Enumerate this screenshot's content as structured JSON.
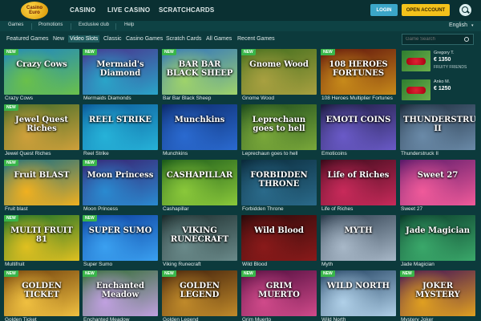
{
  "brand": {
    "logo_text": "Casino Euro"
  },
  "topnav": {
    "casino": "CASINO",
    "live_casino": "LIVE CASINO",
    "scratchcards": "SCRATCHCARDS"
  },
  "auth": {
    "login": "LOGIN",
    "open_account": "OPEN ACCOUNT"
  },
  "subnav": {
    "games": "Games",
    "promotions": "Promotions",
    "exclusive": "Exclusive club",
    "help": "Help",
    "language": "English"
  },
  "categories": [
    "Featured Games",
    "New",
    "Video Slots",
    "Classic",
    "Casino Games",
    "Scratch Cards",
    "All Games",
    "Recent Games"
  ],
  "search": {
    "placeholder": "Game Search"
  },
  "badge": "NEW",
  "winners": [
    {
      "name": "Gregory T.",
      "amount": "€ 1350",
      "game": "FRUITY FRIENDS"
    },
    {
      "name": "Anko M.",
      "amount": "€ 1250",
      "game": ""
    }
  ],
  "games": [
    {
      "label": "Crazy Cows",
      "title": "Crazy Cows",
      "new": true,
      "c1": "#1a84c9",
      "c2": "#6ac04a"
    },
    {
      "label": "Mermaids Diamonds",
      "title": "Mermaid's Diamond",
      "new": true,
      "c1": "#4a2c8a",
      "c2": "#2aa4c8"
    },
    {
      "label": "Bar Bar Black Sheep",
      "title": "BAR BAR BLACK SHEEP",
      "new": true,
      "c1": "#2a6fc4",
      "c2": "#9fd36a"
    },
    {
      "label": "Gnome Wood",
      "title": "Gnome Wood",
      "new": true,
      "c1": "#3c6b1c",
      "c2": "#a8a040"
    },
    {
      "label": "108 Heroes Multiplier Fortunes",
      "title": "108 HEROES FORTUNES",
      "new": true,
      "c1": "#5a0c0c",
      "c2": "#c78a1a"
    },
    {
      "label": "Jewel Quest Riches",
      "title": "Jewel Quest Riches",
      "new": true,
      "c1": "#3a6a2a",
      "c2": "#cfa03a"
    },
    {
      "label": "Reel Strike",
      "title": "REEL STRIKE",
      "new": false,
      "c1": "#0c5a9a",
      "c2": "#26b2d8"
    },
    {
      "label": "Munchkins",
      "title": "Munchkins",
      "new": false,
      "c1": "#0c2a6a",
      "c2": "#2a6ad0"
    },
    {
      "label": "Leprechaun goes to hell",
      "title": "Leprechaun goes to hell",
      "new": false,
      "c1": "#1c4a1c",
      "c2": "#7aa83a"
    },
    {
      "label": "Emoticoins",
      "title": "EMOTI COINS",
      "new": false,
      "c1": "#1a1a3a",
      "c2": "#6a5ac8"
    },
    {
      "label": "Thunderstruck II",
      "title": "THUNDERSTRUCK II",
      "new": false,
      "c1": "#1c2a3a",
      "c2": "#6a8aa8"
    },
    {
      "label": "Fruit blast",
      "title": "Fruit BLAST",
      "new": true,
      "c1": "#0a6a8a",
      "c2": "#f0b020"
    },
    {
      "label": "Moon Princess",
      "title": "Moon Princess",
      "new": true,
      "c1": "#3a1a6a",
      "c2": "#2a8ad0"
    },
    {
      "label": "Cashapillar",
      "title": "CASHAPILLAR",
      "new": false,
      "c1": "#1a5a1a",
      "c2": "#8ac83a"
    },
    {
      "label": "Forbidden Throne",
      "title": "FORBIDDEN THRONE",
      "new": false,
      "c1": "#0a2a3a",
      "c2": "#2a6a8a"
    },
    {
      "label": "Life of Riches",
      "title": "Life of Riches",
      "new": false,
      "c1": "#3a0a1a",
      "c2": "#c82a5a"
    },
    {
      "label": "Sweet 27",
      "title": "Sweet 27",
      "new": false,
      "c1": "#5a1a6a",
      "c2": "#f05a9a"
    },
    {
      "label": "Multifruit",
      "title": "MULTI FRUIT 81",
      "new": true,
      "c1": "#0a6a2a",
      "c2": "#e0c020"
    },
    {
      "label": "Super Sumo",
      "title": "SUPER SUMO",
      "new": true,
      "c1": "#0a3a9a",
      "c2": "#3aa0f0"
    },
    {
      "label": "Viking Runecraft",
      "title": "VIKING RUNECRAFT",
      "new": false,
      "c1": "#1a2a2a",
      "c2": "#6a8a8a"
    },
    {
      "label": "Wild Blood",
      "title": "Wild Blood",
      "new": false,
      "c1": "#2a0a0a",
      "c2": "#8a1a1a"
    },
    {
      "label": "Myth",
      "title": "MYTH",
      "new": false,
      "c1": "#2a3a4a",
      "c2": "#a8b8c8"
    },
    {
      "label": "Jade Magician",
      "title": "Jade Magician",
      "new": false,
      "c1": "#0a3a2a",
      "c2": "#3aa86a"
    },
    {
      "label": "Golden Ticket",
      "title": "GOLDEN TICKET",
      "new": true,
      "c1": "#6a3a0a",
      "c2": "#f0c040"
    },
    {
      "label": "Enchanted Meadow",
      "title": "Enchanted Meadow",
      "new": true,
      "c1": "#2a6a2a",
      "c2": "#c0a0e0"
    },
    {
      "label": "Golden Legend",
      "title": "GOLDEN LEGEND",
      "new": true,
      "c1": "#3a1a0a",
      "c2": "#c08a2a"
    },
    {
      "label": "Grim Muerto",
      "title": "GRIM MUERTO",
      "new": true,
      "c1": "#4a0a3a",
      "c2": "#d04a8a"
    },
    {
      "label": "Wild North",
      "title": "WILD NORTH",
      "new": true,
      "c1": "#1a3a5a",
      "c2": "#b0d0e8"
    },
    {
      "label": "Mystery Joker",
      "title": "JOKER MYSTERY",
      "new": true,
      "c1": "#3a0a5a",
      "c2": "#e0a020"
    }
  ]
}
